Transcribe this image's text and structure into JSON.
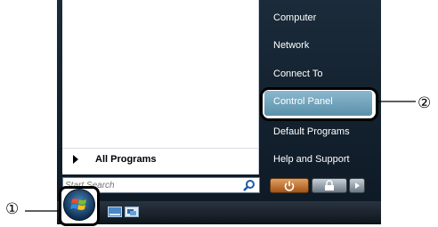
{
  "start_menu": {
    "right_items": {
      "computer": "Computer",
      "network": "Network",
      "connect_to": "Connect To",
      "control_panel": "Control Panel",
      "default_programs": "Default Programs",
      "help_support": "Help and Support"
    },
    "all_programs": "All Programs",
    "search_placeholder": "Start Search"
  },
  "callouts": {
    "one": "①",
    "two": "②"
  },
  "icons": [
    "search-icon",
    "power-icon",
    "lock-icon",
    "arrow-right-icon",
    "windows-logo-icon",
    "show-desktop-icon",
    "switch-windows-icon"
  ]
}
